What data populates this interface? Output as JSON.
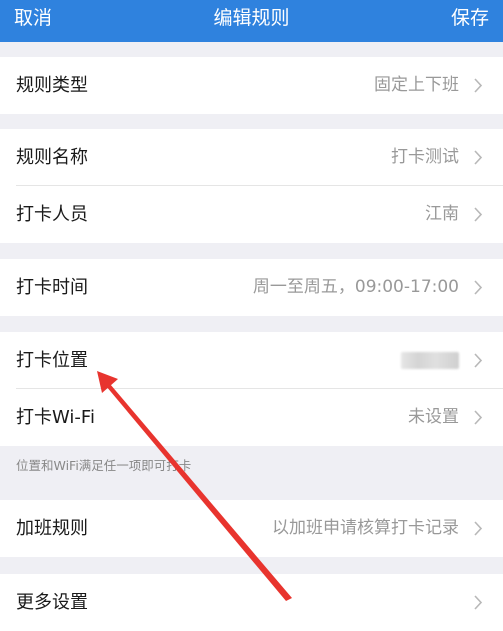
{
  "navbar": {
    "cancel": "取消",
    "title": "编辑规则",
    "save": "保存"
  },
  "rows": {
    "rule_type": {
      "label": "规则类型",
      "value": "固定上下班"
    },
    "rule_name": {
      "label": "规则名称",
      "value": "打卡测试"
    },
    "members": {
      "label": "打卡人员",
      "value": "江南"
    },
    "time": {
      "label": "打卡时间",
      "value": "周一至周五，09:00-17:00"
    },
    "location": {
      "label": "打卡位置"
    },
    "wifi": {
      "label": "打卡Wi-Fi",
      "value": "未设置"
    },
    "overtime": {
      "label": "加班规则",
      "value": "以加班申请核算打卡记录"
    },
    "more": {
      "label": "更多设置"
    }
  },
  "hint": "位置和WiFi满足任一项即可打卡",
  "icons": {
    "chevron": "chevron-right-icon",
    "annotation": "red-arrow-annotation"
  },
  "colors": {
    "navbar": "#2f82de",
    "arrow": "#e8342e"
  }
}
